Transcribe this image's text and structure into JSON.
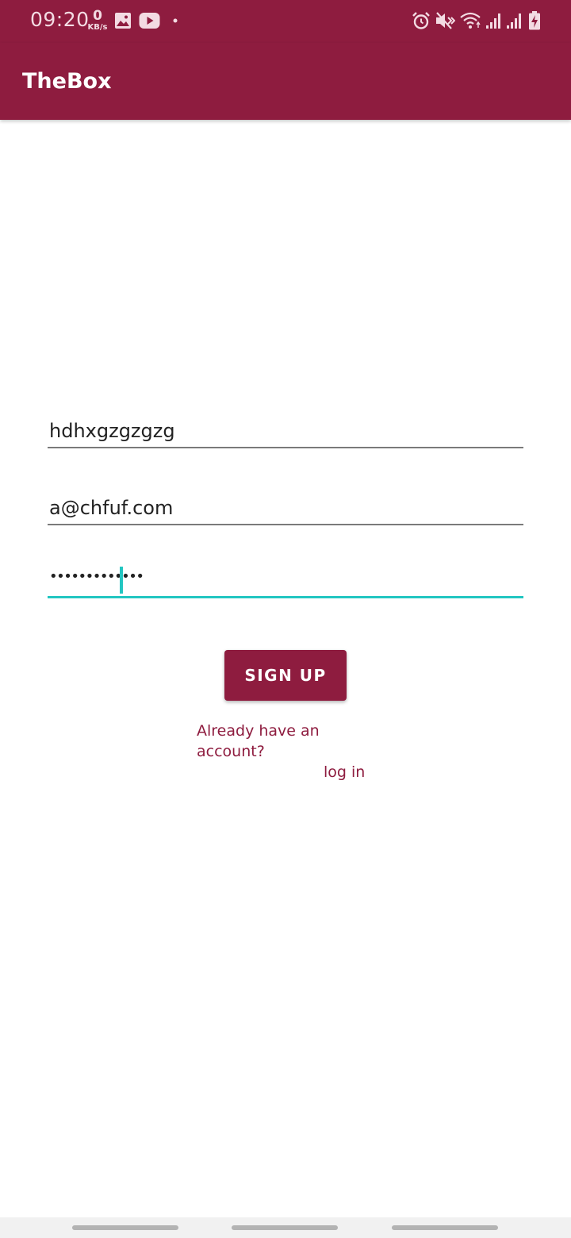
{
  "status_bar": {
    "time": "09:20",
    "net_speed_value": "0",
    "net_speed_unit": "KB/s",
    "left_icons": [
      "gallery-icon",
      "youtube-icon",
      "dot-icon"
    ],
    "right_icons": [
      "alarm-icon",
      "mute-icon",
      "wifi-icon",
      "signal-1-icon",
      "signal-2-icon",
      "battery-charging-icon"
    ],
    "color": "#8e1c3f"
  },
  "app_bar": {
    "title": "TheBox",
    "color": "#8e1c3f"
  },
  "form": {
    "username_value": "hdhxgzgzgzg",
    "email_value": "a@chfuf.com",
    "password_value": "•••••••••••••",
    "accent_color": "#22c6c1"
  },
  "signup_button": {
    "label": "SIGN UP"
  },
  "login_prompt": {
    "question": "Already have an account?",
    "link": "log in"
  }
}
